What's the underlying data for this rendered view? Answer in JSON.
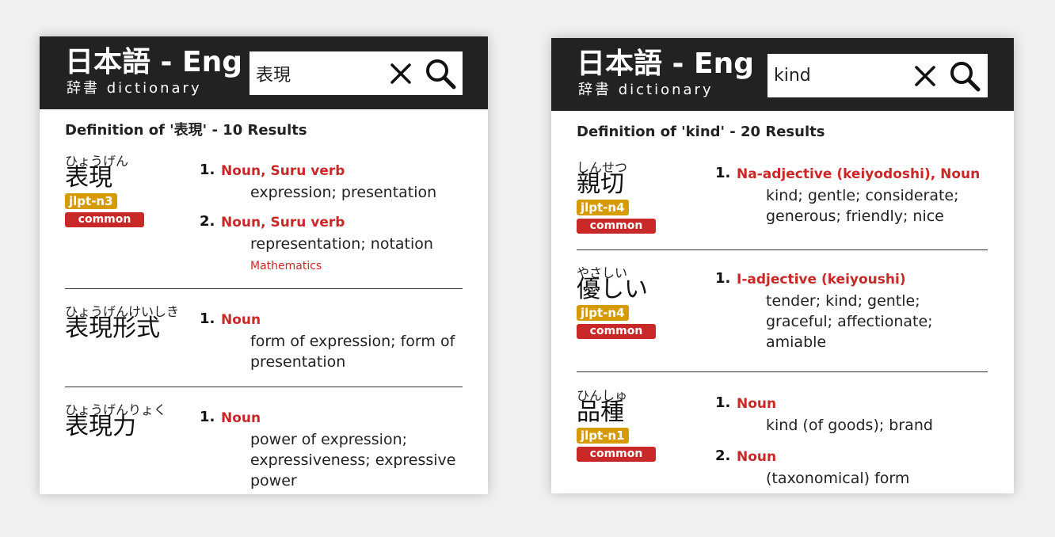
{
  "panels": [
    {
      "header": {
        "title": "日本語 - Eng",
        "subtitle": "辞書 dictionary"
      },
      "search": {
        "query": "表現"
      },
      "summary": {
        "prefix": "Definition of '",
        "term": "表現",
        "suffix": "' - 10 Results"
      },
      "entries": [
        {
          "reading": "ひょうげん",
          "word": "表現",
          "jlpt": "jlpt-n3",
          "common": "common",
          "senses": [
            {
              "num": "1.",
              "pos": "Noun, Suru verb",
              "gloss": "expression; presentation"
            },
            {
              "num": "2.",
              "pos": "Noun, Suru verb",
              "gloss": "representation; notation",
              "tag": "Mathematics"
            }
          ]
        },
        {
          "reading": "ひょうげんけいしき",
          "word": "表現形式",
          "senses": [
            {
              "num": "1.",
              "pos": "Noun",
              "gloss": "form of expression; form of presentation"
            }
          ]
        },
        {
          "reading": "ひょうげんりょく",
          "word": "表現力",
          "senses": [
            {
              "num": "1.",
              "pos": "Noun",
              "gloss": "power of expression; expressiveness; expressive power"
            }
          ]
        }
      ]
    },
    {
      "header": {
        "title": "日本語 - Eng",
        "subtitle": "辞書 dictionary"
      },
      "search": {
        "query": "kind"
      },
      "summary": {
        "prefix": "Definition of '",
        "term": "kind",
        "suffix": "' - 20 Results"
      },
      "entries": [
        {
          "reading": "しんせつ",
          "word": "親切",
          "jlpt": "jlpt-n4",
          "common": "common",
          "senses": [
            {
              "num": "1.",
              "pos": "Na-adjective (keiyodoshi), Noun",
              "gloss": "kind; gentle; considerate; generous; friendly; nice"
            }
          ]
        },
        {
          "reading": "やさしい",
          "word": "優しい",
          "jlpt": "jlpt-n4",
          "common": "common",
          "senses": [
            {
              "num": "1.",
              "pos": "I-adjective (keiyoushi)",
              "gloss": "tender; kind; gentle; graceful; affectionate; amiable"
            }
          ]
        },
        {
          "reading": "ひんしゅ",
          "word": "品種",
          "jlpt": "jlpt-n1",
          "common": "common",
          "senses": [
            {
              "num": "1.",
              "pos": "Noun",
              "gloss": "kind (of goods); brand"
            },
            {
              "num": "2.",
              "pos": "Noun",
              "gloss": "(taxonomical) form"
            }
          ]
        }
      ]
    }
  ],
  "icons": {
    "clear": "close-icon",
    "search": "search-icon"
  },
  "colors": {
    "header_bg": "#222222",
    "accent_red": "#c92828",
    "jlpt_gold": "#d59b00"
  }
}
